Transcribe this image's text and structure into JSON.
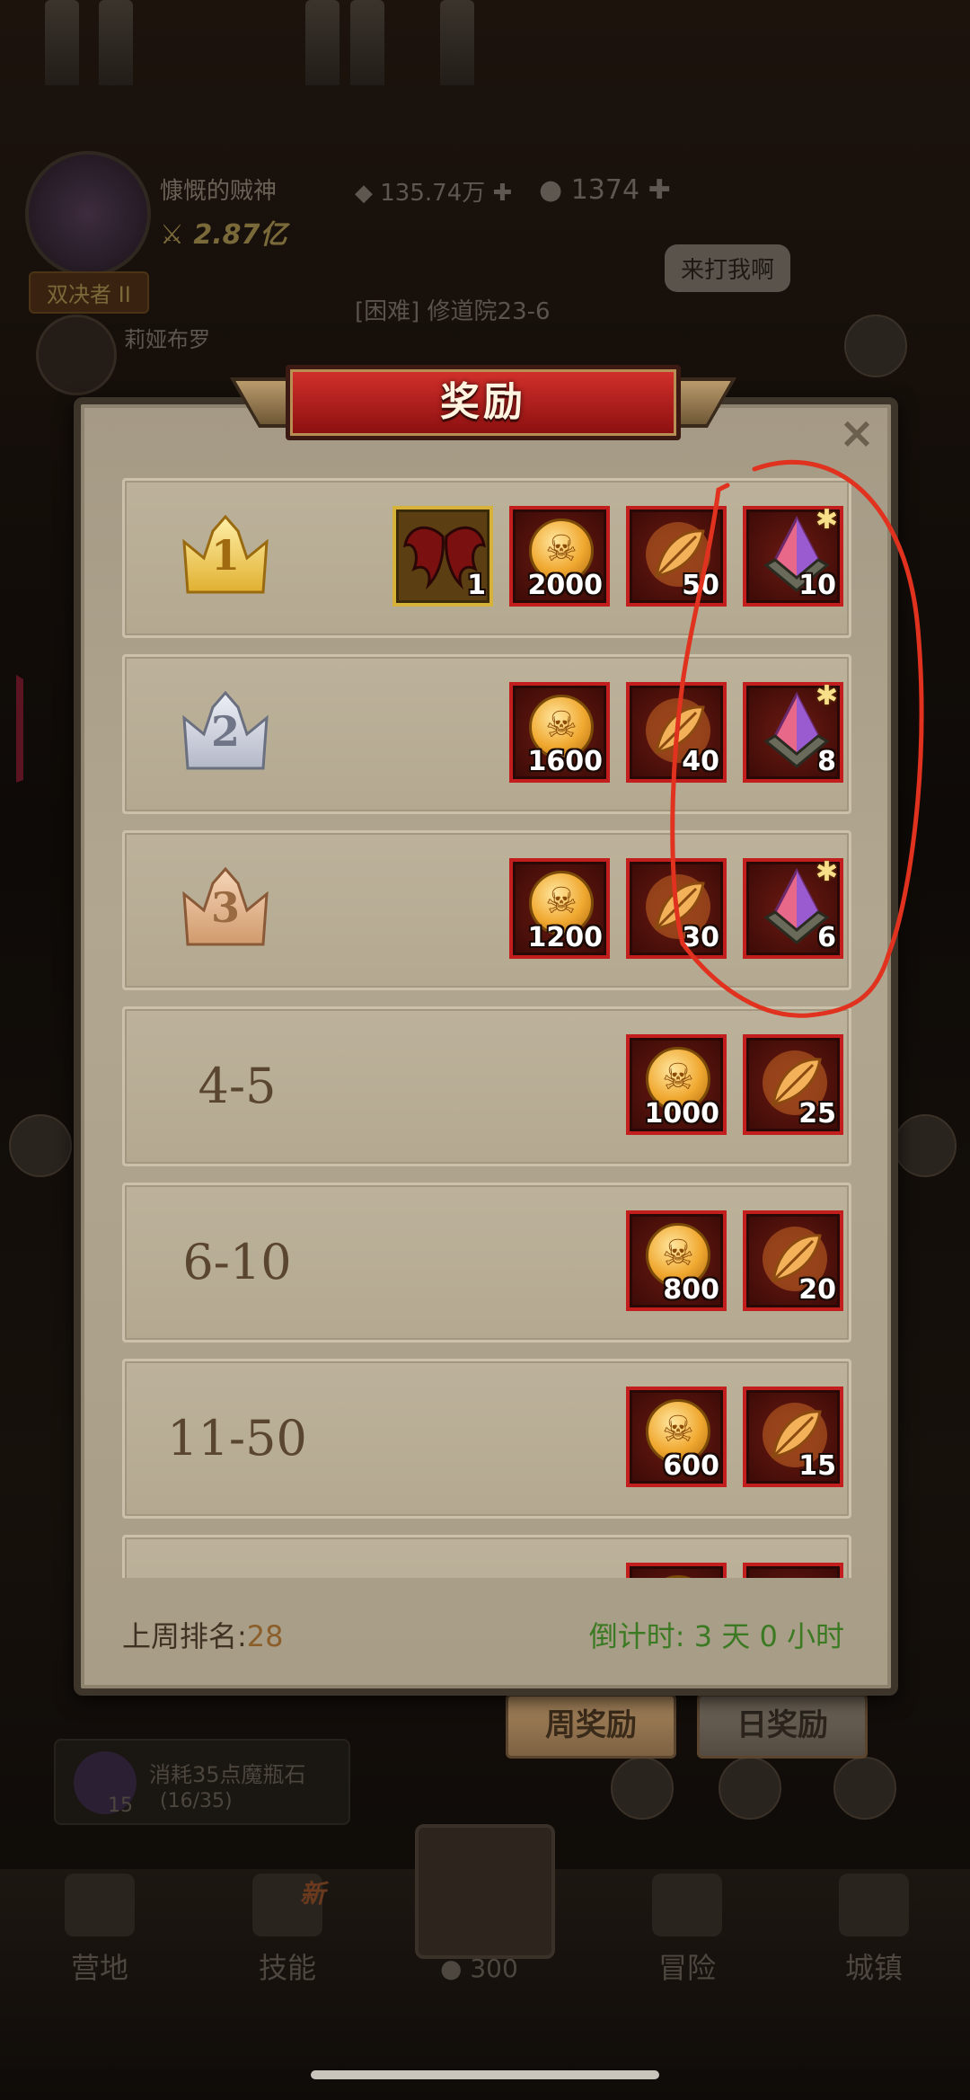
{
  "background": {
    "player_name": "慷慨的贼神",
    "player_power": "2.87亿",
    "gems": "135.74万",
    "coins": "1374",
    "title_badge": "双决者 II",
    "speech_bubble": "来打我啊",
    "hero_name": "莉娅布罗",
    "stage": "[困难] 修道院23-6",
    "quest_text": "消耗35点魔瓶石",
    "quest_progress": "(16/35)",
    "quest_count": "15",
    "nav": {
      "base": "营地",
      "skills": "技能",
      "new_badge": "新",
      "center_count": "300",
      "adventure": "冒险",
      "city": "城镇"
    }
  },
  "modal": {
    "title": "奖励",
    "close_label": "×",
    "rows": [
      {
        "rank": "1",
        "type": "crown",
        "crown_color": "gold",
        "items": [
          {
            "icon": "wings-icon",
            "count": "1",
            "frame": "gold"
          },
          {
            "icon": "coin-icon",
            "count": "2000"
          },
          {
            "icon": "feather-icon",
            "count": "50"
          },
          {
            "icon": "crystal-icon",
            "count": "10",
            "star": true
          }
        ]
      },
      {
        "rank": "2",
        "type": "crown",
        "crown_color": "silver",
        "items": [
          {
            "icon": "coin-icon",
            "count": "1600"
          },
          {
            "icon": "feather-icon",
            "count": "40"
          },
          {
            "icon": "crystal-icon",
            "count": "8",
            "star": true
          }
        ]
      },
      {
        "rank": "3",
        "type": "crown",
        "crown_color": "bronze",
        "items": [
          {
            "icon": "coin-icon",
            "count": "1200"
          },
          {
            "icon": "feather-icon",
            "count": "30"
          },
          {
            "icon": "crystal-icon",
            "count": "6",
            "star": true
          }
        ]
      },
      {
        "rank": "4-5",
        "type": "text",
        "items": [
          {
            "icon": "coin-icon",
            "count": "1000"
          },
          {
            "icon": "feather-icon",
            "count": "25"
          }
        ]
      },
      {
        "rank": "6-10",
        "type": "text",
        "items": [
          {
            "icon": "coin-icon",
            "count": "800"
          },
          {
            "icon": "feather-icon",
            "count": "20"
          }
        ]
      },
      {
        "rank": "11-50",
        "type": "text",
        "items": [
          {
            "icon": "coin-icon",
            "count": "600"
          },
          {
            "icon": "feather-icon",
            "count": "15"
          }
        ]
      },
      {
        "rank": "",
        "type": "text",
        "items": [
          {
            "icon": "coin-icon",
            "count": ""
          },
          {
            "icon": "feather-icon",
            "count": ""
          }
        ]
      }
    ],
    "footer": {
      "last_week_label": "上周排名:",
      "last_week_value": "28",
      "countdown": "倒计时: 3 天 0 小时"
    }
  },
  "tabs": {
    "weekly": "周奖励",
    "daily": "日奖励"
  },
  "colors": {
    "annotation": "#e0321e",
    "item_frame": "#c21e1e",
    "countdown": "#3b7a22"
  }
}
